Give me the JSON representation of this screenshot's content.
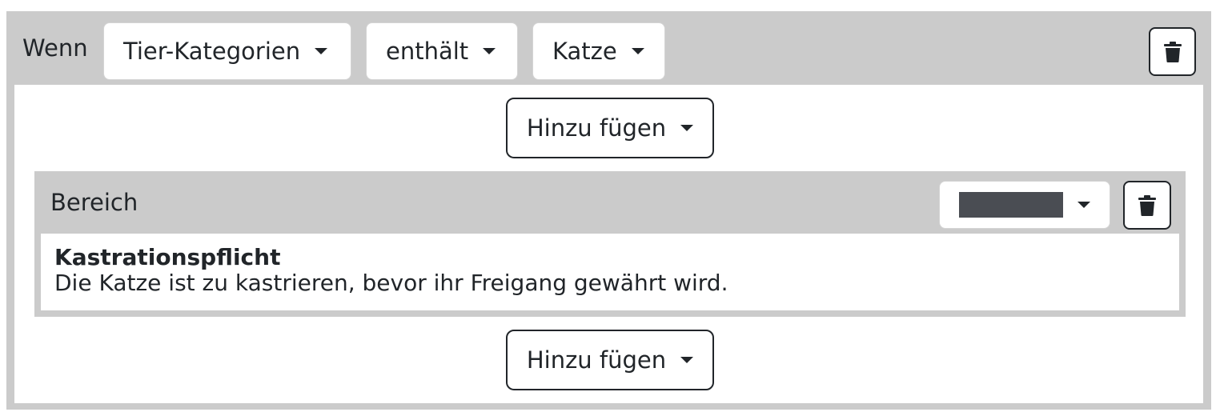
{
  "condition": {
    "label": "Wenn",
    "field_select": "Tier-Kategorien",
    "operator_select": "enthält",
    "value_select": "Katze",
    "delete_icon": "trash-icon"
  },
  "add_buttons": {
    "top_label": "Hinzu fügen",
    "bottom_label": "Hinzu fügen"
  },
  "section": {
    "title": "Bereich",
    "color_select_value": "#4a4d53",
    "delete_icon": "trash-icon",
    "rule_title": "Kastrationspflicht",
    "rule_text": "Die Katze ist zu kastrieren, bevor ihr Freigang gewährt wird."
  },
  "colors": {
    "panel_gray": "#cbcbcb",
    "white": "#ffffff",
    "text": "#212529"
  }
}
